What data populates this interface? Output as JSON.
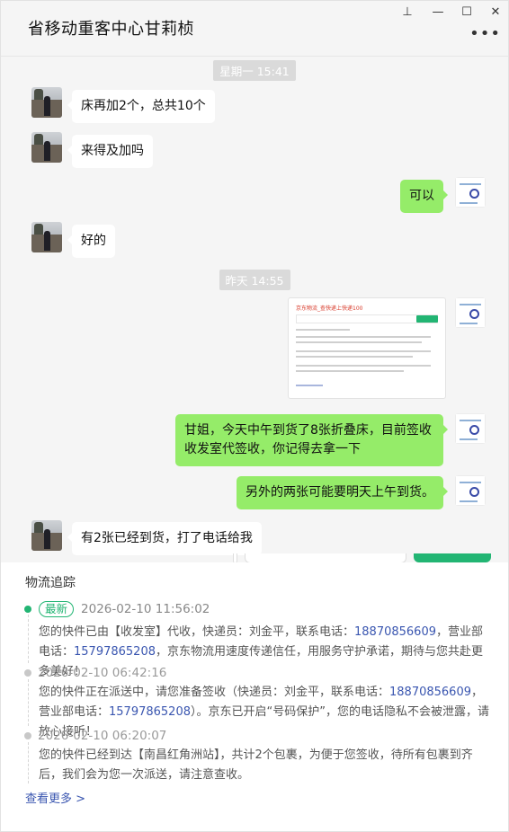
{
  "window": {
    "chat_title": "省移动重客中心甘莉桢",
    "pin_icon": "⊥",
    "minimize_icon": "—",
    "maximize_icon": "☐",
    "close_icon": "✕",
    "more_icon": "•••"
  },
  "messages": {
    "time_1": "星期一 15:41",
    "msg_1": "床再加2个，总共10个",
    "msg_2": "来得及加吗",
    "msg_3": "可以",
    "msg_4": "好的",
    "time_2": "昨天 14:55",
    "msg_5_line1": "甘姐，今天中午到货了8张折叠床，目前签收",
    "msg_5_line2": "收发室代签收，你记得去拿一下",
    "msg_6": "另外的两张可能要明天上午到货。",
    "msg_7": "有2张已经到货，打了电话给我"
  },
  "shared_image": {
    "title": "京东物流_查快递上快递100"
  },
  "tracking": {
    "title": "物流追踪",
    "events": [
      {
        "badge": "最新",
        "time": "2026-02-10 11:56:02",
        "text_a": "您的快件已由【收发室】代收，快递员：刘金平，联系电话：",
        "phone_a": "18870856609",
        "text_b": "，营业部电话：",
        "phone_b": "15797865208",
        "text_c": "，京东物流用速度传递信任，用服务守护承诺，期待与您共赴更多美好！"
      },
      {
        "time": "2026-02-10 06:42:16",
        "text_a": "您的快件正在派送中，请您准备签收（快递员：刘金平，联系电话：",
        "phone_a": "18870856609",
        "text_b": "，营业部电话：",
        "phone_b": "15797865208",
        "text_c": "）。京东已开启“号码保护”，您的电话隐私不会被泄露，请放心接听！"
      },
      {
        "time": "2026-02-10 06:20:07",
        "text": "您的快件已经到达【南昌红角洲站】，共计2个包裹，为便于您签收，待所有包裹到齐后，我们会为您一次派送，请注意查收。"
      }
    ],
    "see_more": "查看更多 >"
  }
}
